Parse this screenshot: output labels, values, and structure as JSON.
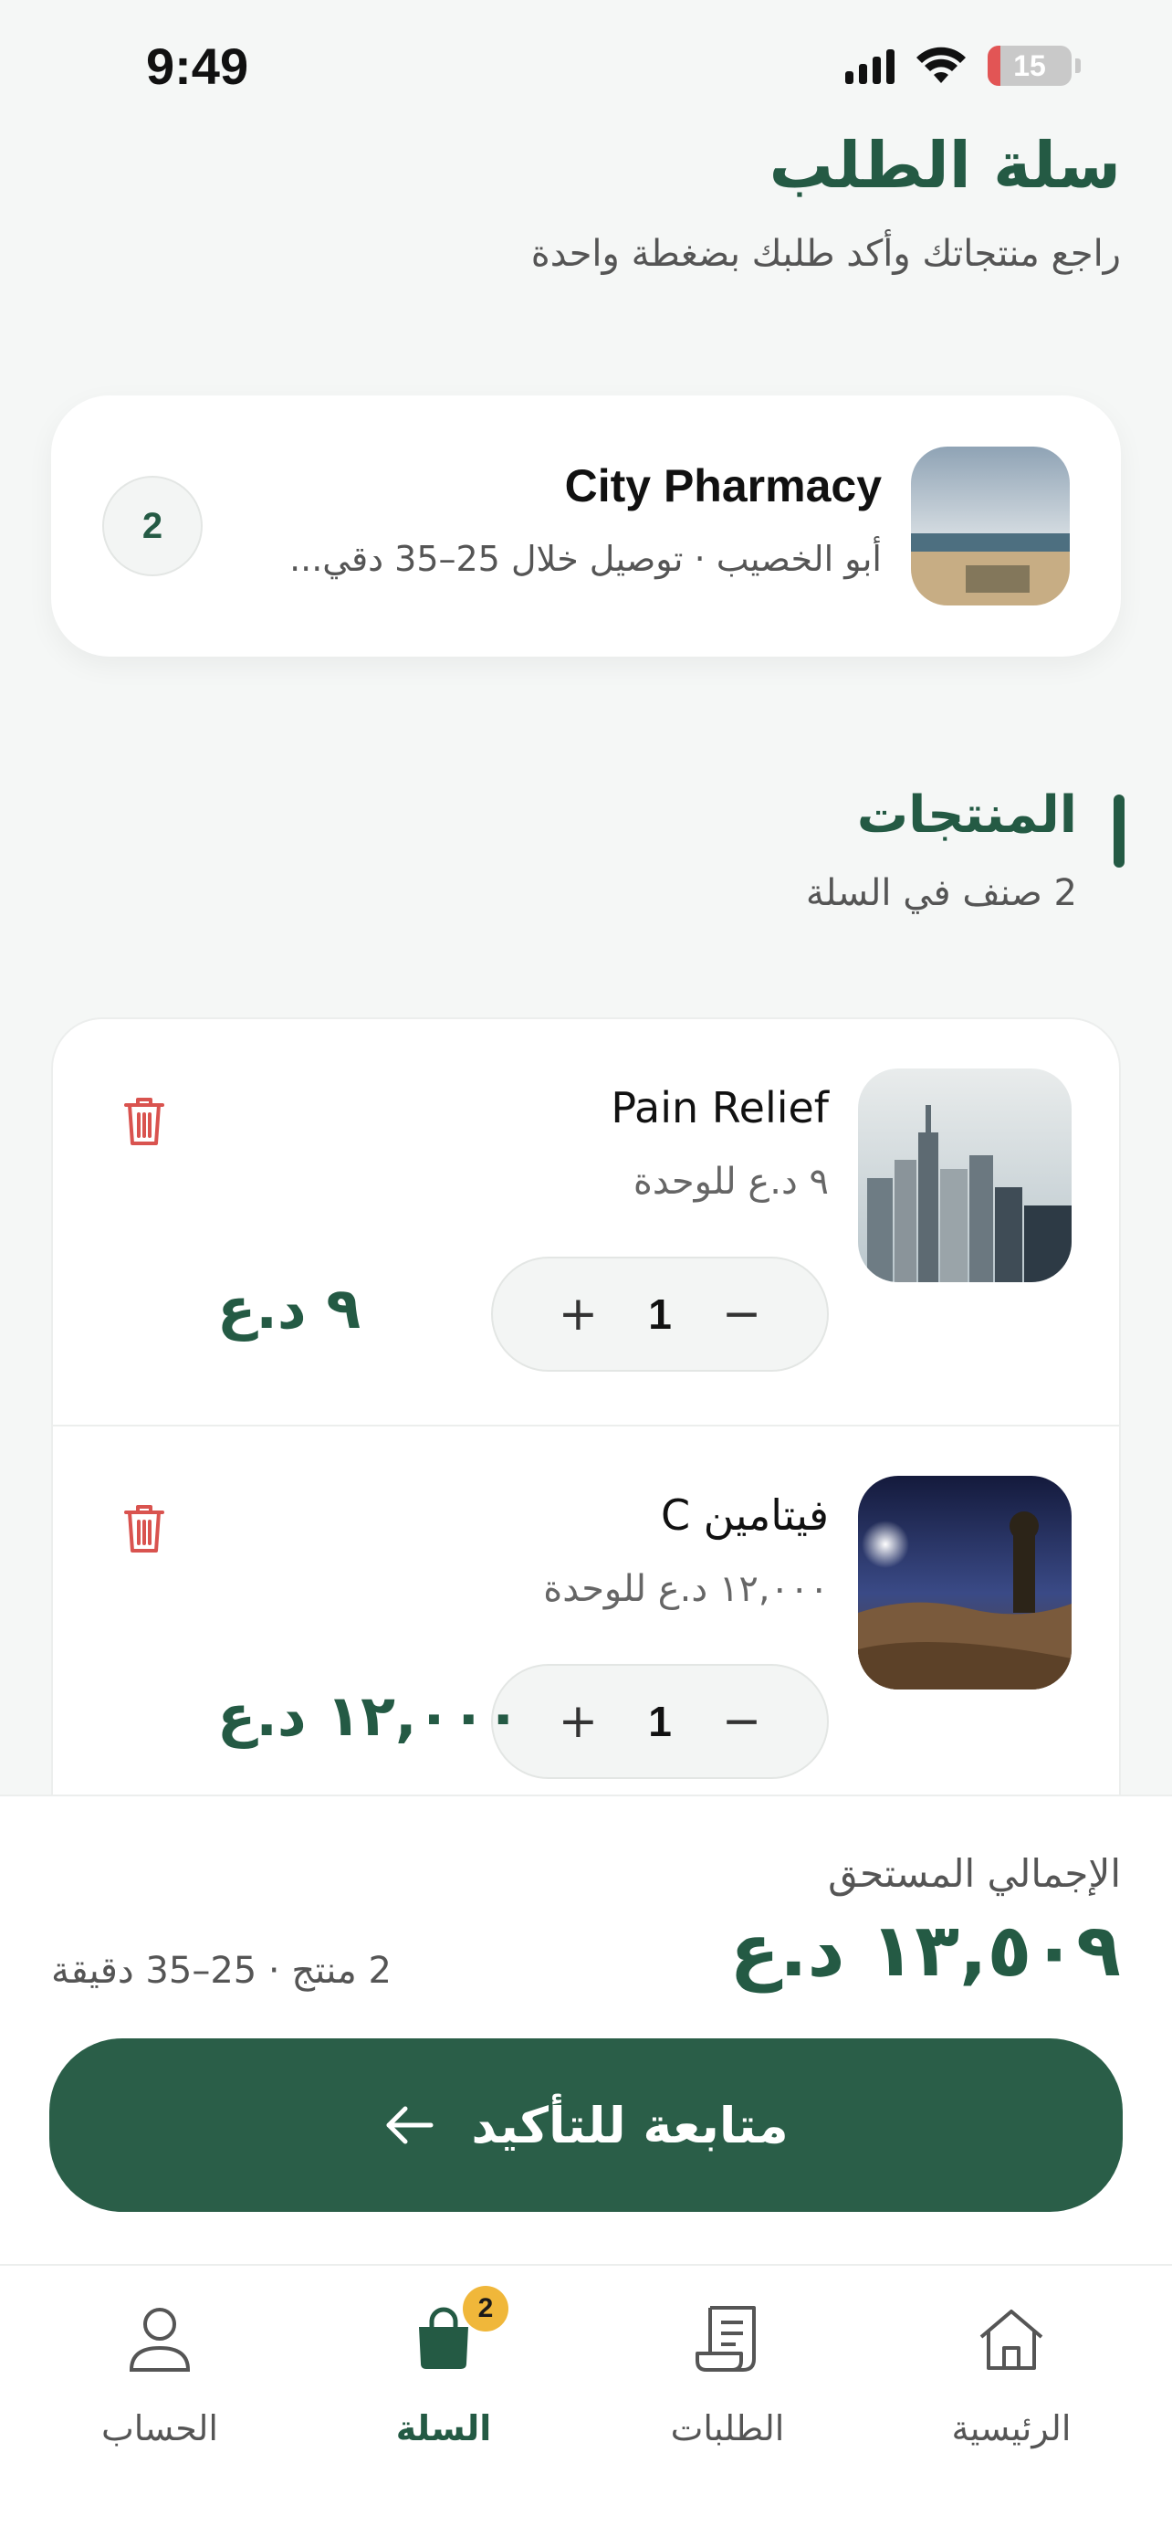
{
  "status_bar": {
    "time": "9:49",
    "battery": "15",
    "battery_level": 0.15
  },
  "header": {
    "title": "سلة الطلب",
    "subtitle": "راجع منتجاتك وأكد طلبك بضغطة واحدة"
  },
  "pharmacy": {
    "name": "City Pharmacy",
    "meta": "أبو الخصيب · توصيل خلال 25–35 دقي...",
    "item_count": "2",
    "thumb_icon": "beach-photo"
  },
  "products_section": {
    "title": "المنتجات",
    "subtitle": "2 صنف في السلة"
  },
  "products": [
    {
      "name": "Pain Relief",
      "unit_price": "٩ د.ع للوحدة",
      "quantity": "1",
      "total": "٩ د.ع",
      "minus": "−",
      "plus": "+",
      "thumb_icon": "city-photo"
    },
    {
      "name": "فيتامين C",
      "unit_price": "١٢,٠٠٠ د.ع للوحدة",
      "quantity": "1",
      "total": "١٢,٠٠٠ د.ع",
      "minus": "−",
      "plus": "+",
      "thumb_icon": "night-desert-photo"
    }
  ],
  "checkout": {
    "total_label": "الإجمالي المستحق",
    "total_value": "١٣,٥٠٩ د.ع",
    "summary": "2 منتج · 25–35 دقيقة",
    "confirm_label": "متابعة للتأكيد"
  },
  "bottom_nav": {
    "account": "الحساب",
    "cart": "السلة",
    "cart_badge": "2",
    "orders": "الطلبات",
    "home": "الرئيسية"
  },
  "colors": {
    "brand": "#245a44",
    "button": "#2a5e48",
    "delete": "#d9534f",
    "badge": "#f0b73a",
    "background": "#f5f7f6"
  }
}
